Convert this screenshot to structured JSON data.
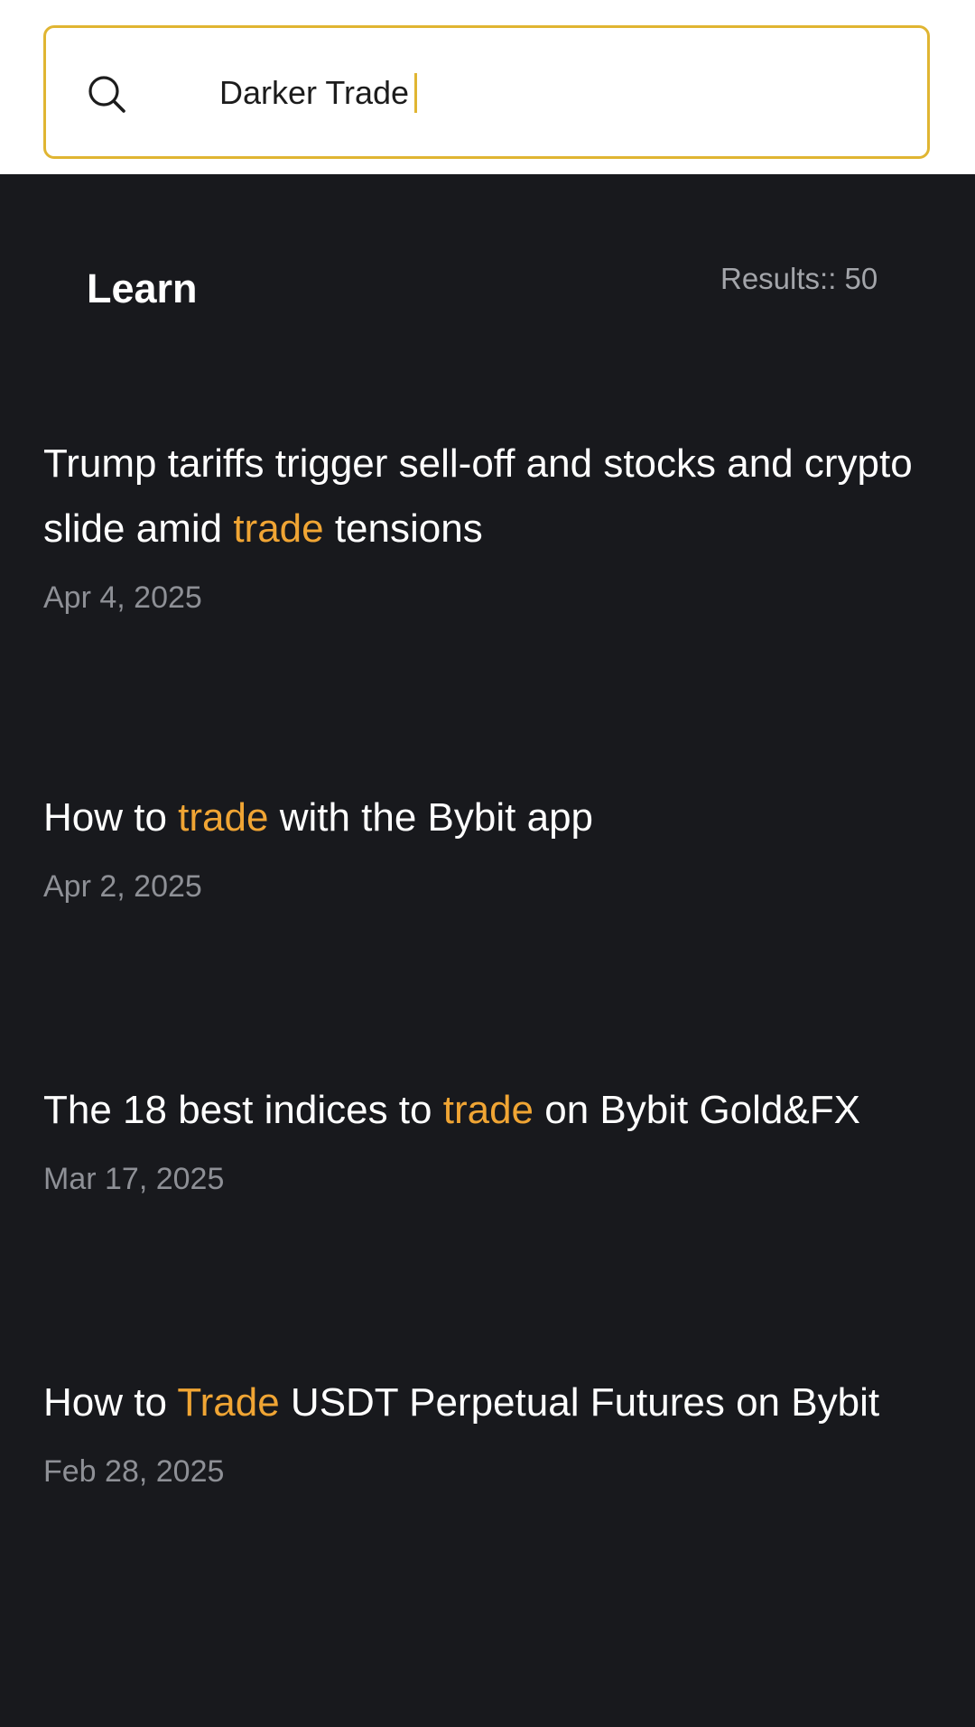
{
  "search": {
    "query": "Darker Trade",
    "icon": "search-icon",
    "border_color": "#e0b532"
  },
  "section": {
    "title": "Learn",
    "results": "Results:: 50"
  },
  "highlight_color": "#f0a534",
  "articles": [
    {
      "title_parts": [
        "Trump tariffs trigger sell-off and stocks and crypto slide amid ",
        "trade",
        " tensions"
      ],
      "date": "Apr 4, 2025"
    },
    {
      "title_parts": [
        "How to ",
        "trade",
        " with the Bybit app"
      ],
      "date": "Apr 2, 2025"
    },
    {
      "title_parts": [
        "The 18 best indices to ",
        "trade",
        " on Bybit Gold&FX"
      ],
      "date": "Mar 17, 2025"
    },
    {
      "title_parts": [
        "How to ",
        "Trade",
        " USDT Perpetual Futures on Bybit"
      ],
      "date": "Feb 28, 2025"
    }
  ]
}
